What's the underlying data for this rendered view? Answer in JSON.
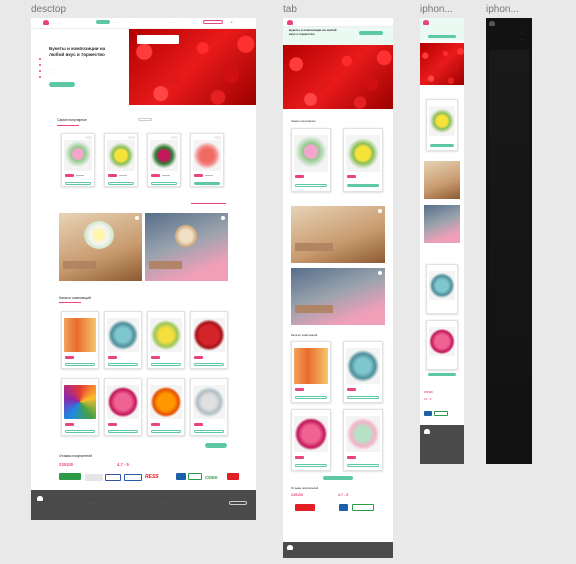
{
  "frames": {
    "desktop": "desctop",
    "tablet": "tab",
    "iphone1": "iphon...",
    "iphone2": "iphon..."
  },
  "hero": {
    "title": "Букеты и композиции на любой вкус и торжество"
  },
  "sections": {
    "popular": "Самое популярное",
    "catalog": "Каталог композиций",
    "reviews": "Отзывы покупателей"
  },
  "reviews": {
    "count": "235100",
    "rating": "4.7 - 5"
  },
  "partners": [
    "Pochta",
    "RESS",
    "CDEK"
  ],
  "colors": {
    "accent_green": "#5cc8a5",
    "accent_pink": "#e8457f",
    "footer": "#4a4a4a"
  },
  "icons": [
    "logo-icon",
    "flower-icon",
    "heart-icon",
    "arrow-left-icon",
    "arrow-right-icon"
  ]
}
